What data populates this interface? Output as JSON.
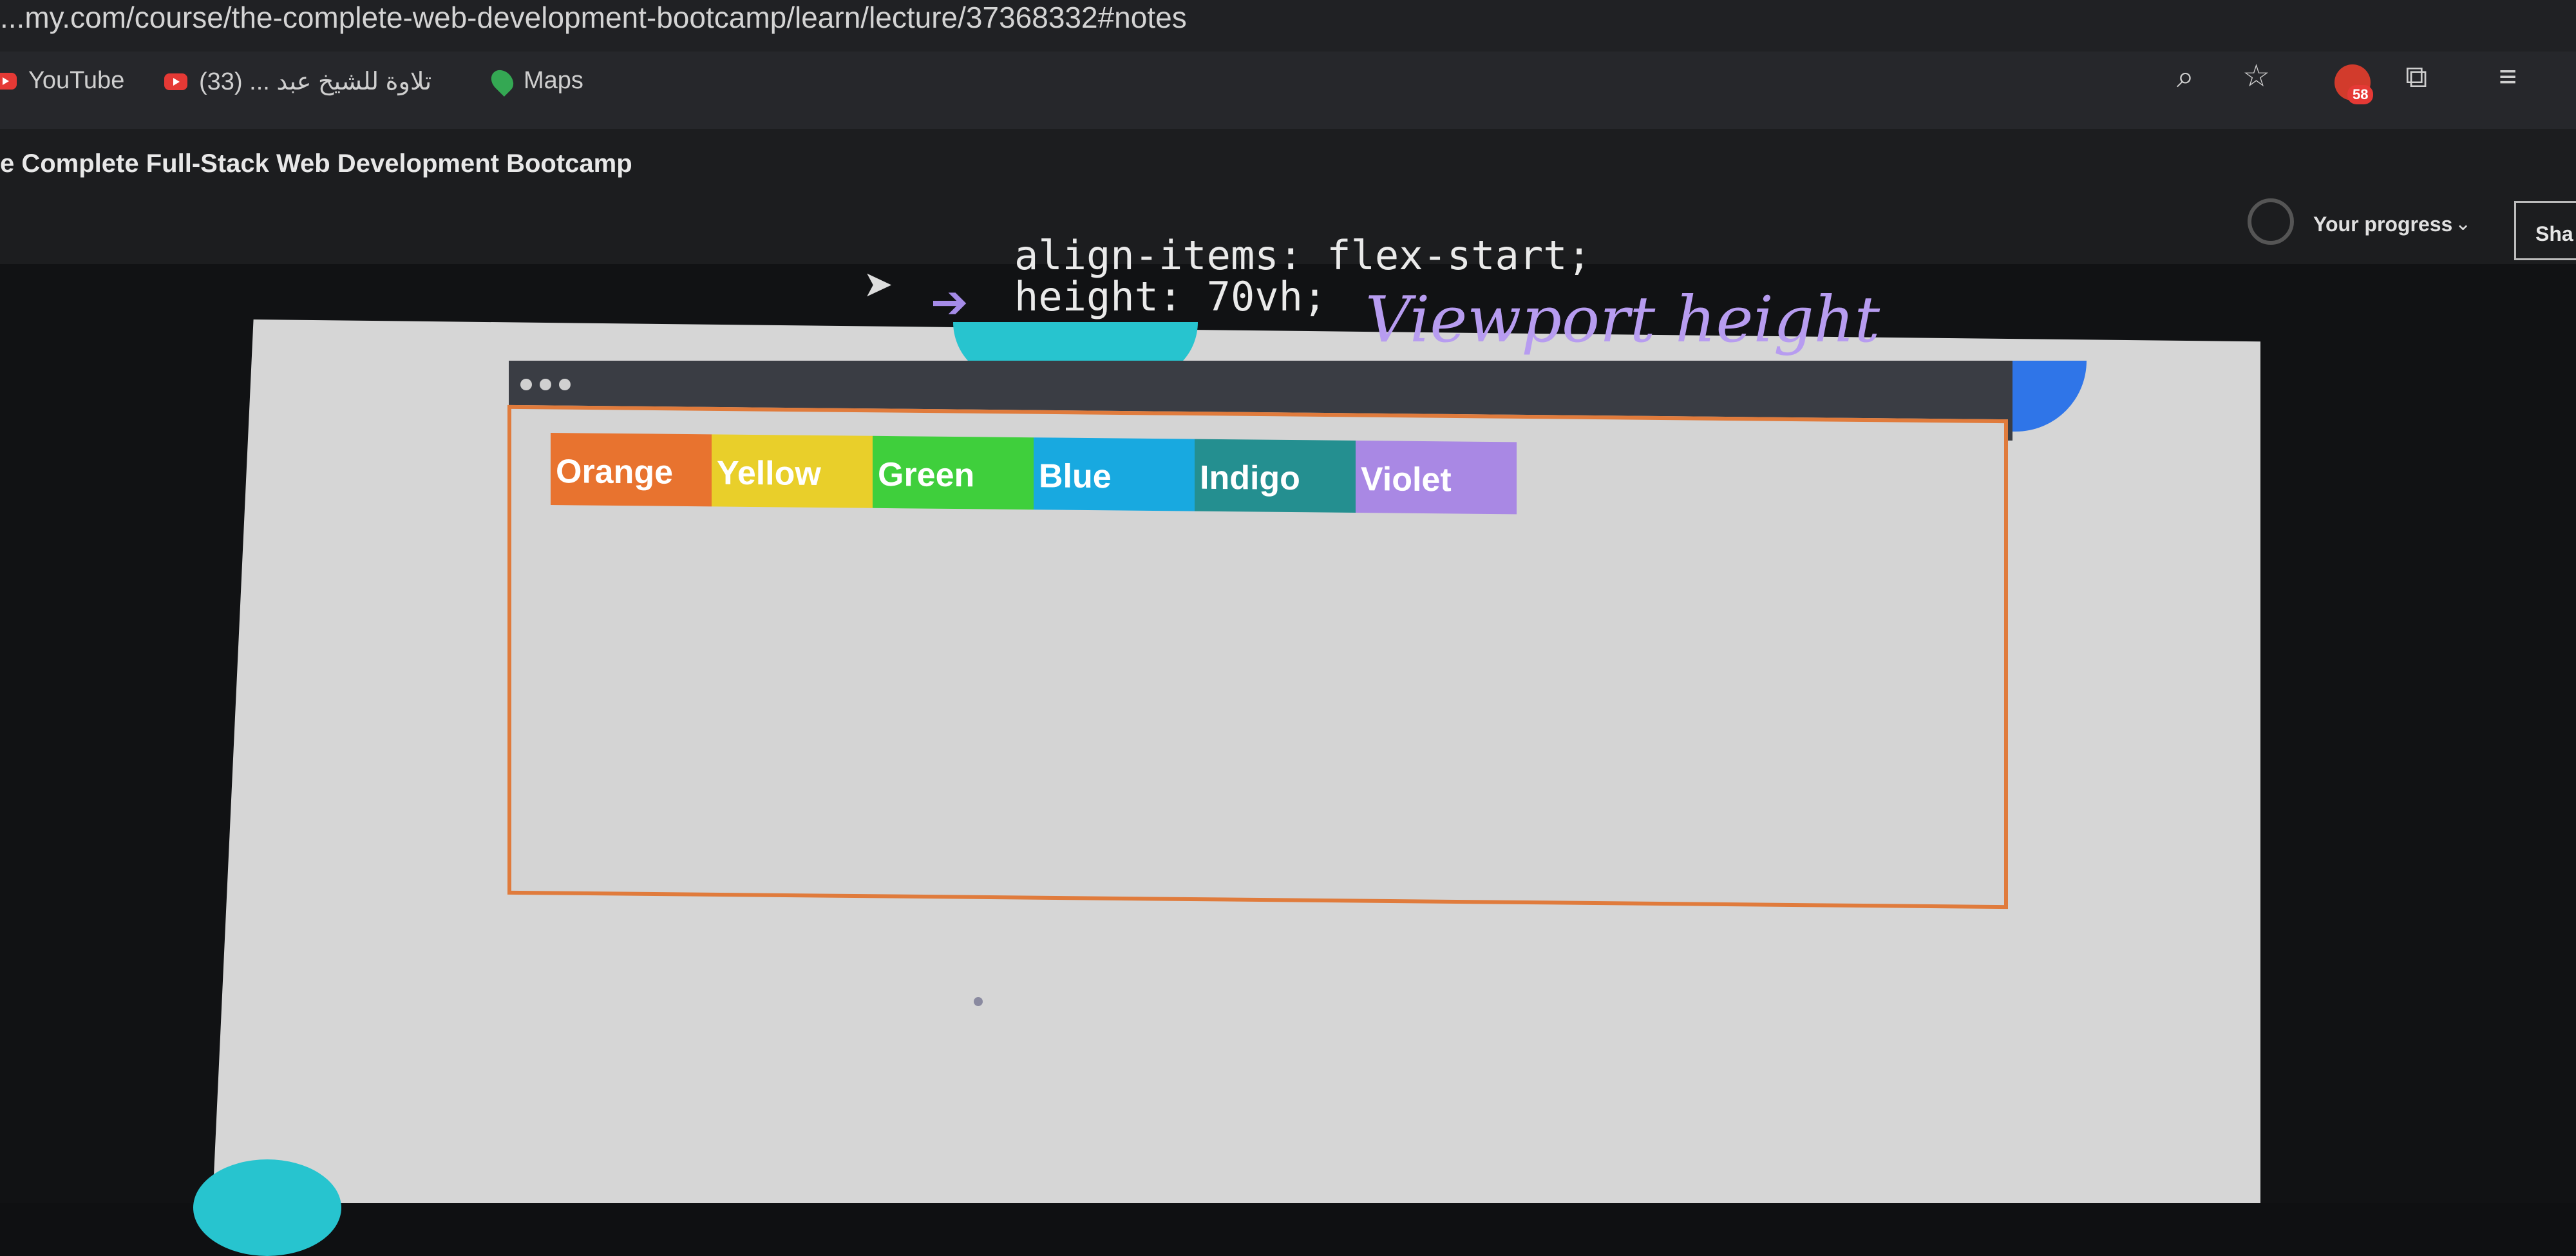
{
  "browser": {
    "url": "...my.com/course/the-complete-web-development-bootcamp/learn/lecture/37368332#notes",
    "bookmarks": [
      {
        "label": "YouTube"
      },
      {
        "label": "تلاوة للشيخ عبد ... (33)"
      },
      {
        "label": "Maps"
      }
    ],
    "extension_badge_count": "58"
  },
  "app": {
    "course_title": "e Complete Full-Stack Web Development Bootcamp",
    "progress_label": "Your progress",
    "share_label": "Sha"
  },
  "lecture": {
    "code_line1": "align-items: flex-start;",
    "code_line2": "height: 70vh;",
    "annotation": "Viewport height",
    "arrow": "➔"
  },
  "demo": {
    "boxes": [
      {
        "label": "Orange",
        "color": "#e8732f"
      },
      {
        "label": "Yellow",
        "color": "#e9cf2a"
      },
      {
        "label": "Green",
        "color": "#3fcf3c"
      },
      {
        "label": "Blue",
        "color": "#18a9e0"
      },
      {
        "label": "Indigo",
        "color": "#248f90"
      },
      {
        "label": "Violet",
        "color": "#a988e4"
      }
    ],
    "border_color": "#e07b3c"
  }
}
